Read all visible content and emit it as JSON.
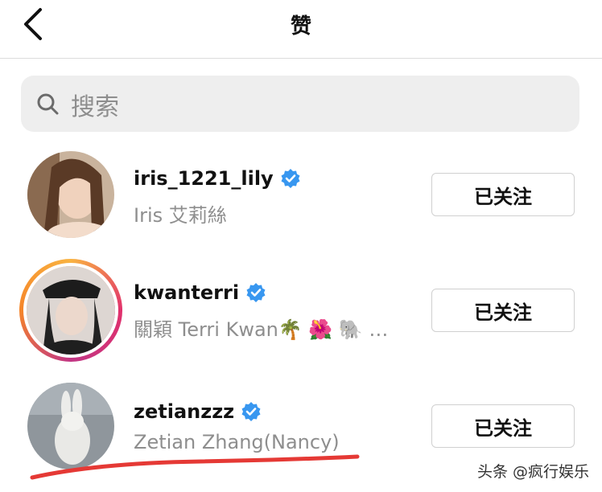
{
  "header": {
    "title": "赞"
  },
  "search": {
    "placeholder": "搜索",
    "icon": "search-icon"
  },
  "follow_label": "已关注",
  "users": [
    {
      "username": "iris_1221_lily",
      "full_name": "Iris 艾莉絲",
      "verified": true
    },
    {
      "username": "kwanterri",
      "full_name": "關穎 Terri Kwan🌴 🌺 🐘 …",
      "verified": true
    },
    {
      "username": "zetianzzz",
      "full_name": "Zetian Zhang(Nancy)",
      "verified": true
    }
  ],
  "watermark": "头条 @疯行娱乐",
  "colors": {
    "accent": "#3897f0",
    "secondary_text": "#8e8e8e",
    "annotation": "#e53935"
  }
}
